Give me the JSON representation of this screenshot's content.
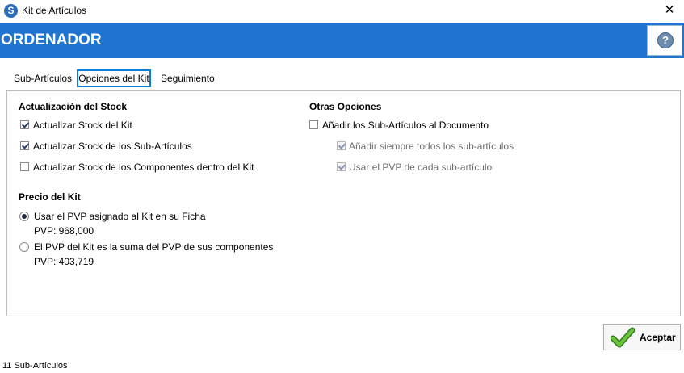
{
  "window": {
    "title": "Kit de Artículos",
    "app_icon": "S",
    "close_glyph": "✕"
  },
  "banner": {
    "title": "ORDENADOR",
    "help_glyph": "?",
    "color": "#1f74d0"
  },
  "tabs": [
    {
      "label": "Sub-Artículos",
      "selected": false
    },
    {
      "label": "Opciones del Kit",
      "selected": true
    },
    {
      "label": "Seguimiento",
      "selected": false
    }
  ],
  "stock": {
    "title": "Actualización del Stock",
    "options": [
      {
        "label": "Actualizar Stock del Kit",
        "checked": true
      },
      {
        "label": "Actualizar Stock de los Sub-Artículos",
        "checked": true
      },
      {
        "label": "Actualizar Stock de los Componentes dentro del Kit",
        "checked": false
      }
    ]
  },
  "price": {
    "title": "Precio del Kit",
    "options": [
      {
        "label": "Usar el PVP asignado al Kit en su Ficha",
        "value": "PVP: 968,000",
        "selected": true
      },
      {
        "label": "El PVP del Kit es la suma del PVP de sus componentes",
        "value": "PVP: 403,719",
        "selected": false
      }
    ]
  },
  "other": {
    "title": "Otras Opciones",
    "main_option": {
      "label": "Añadir los Sub-Artículos al Documento",
      "checked": false
    },
    "sub_options": [
      {
        "label": "Añadir siempre todos los sub-artículos",
        "checked": true,
        "enabled": false
      },
      {
        "label": "Usar el PVP de cada sub-artículo",
        "checked": true,
        "enabled": false
      }
    ]
  },
  "accept_button": {
    "label": "Aceptar",
    "icon": "checkmark-icon"
  },
  "status_bar": {
    "text": "11 Sub-Artículos"
  }
}
